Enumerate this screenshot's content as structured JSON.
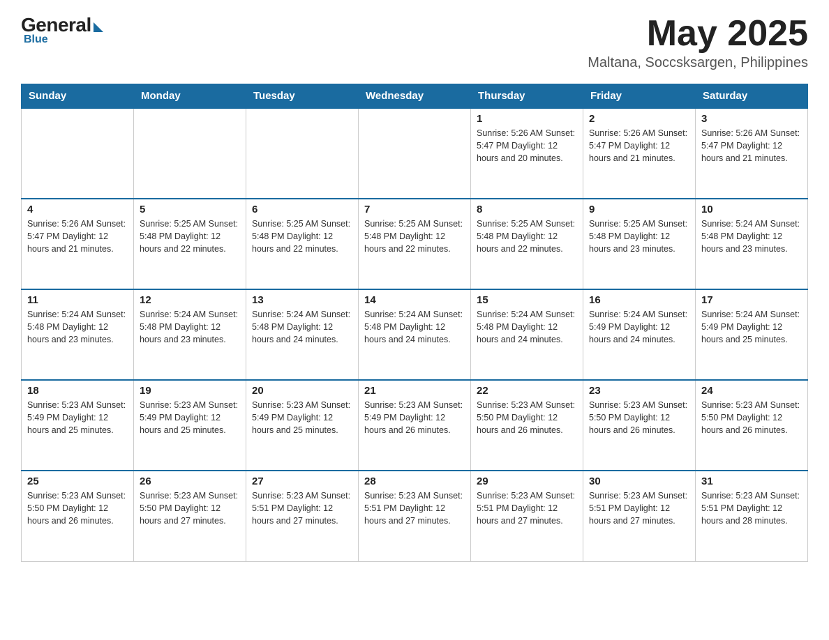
{
  "header": {
    "logo": {
      "general": "General",
      "blue": "Blue"
    },
    "title": "May 2025",
    "location": "Maltana, Soccsksargen, Philippines"
  },
  "calendar": {
    "days_of_week": [
      "Sunday",
      "Monday",
      "Tuesday",
      "Wednesday",
      "Thursday",
      "Friday",
      "Saturday"
    ],
    "weeks": [
      {
        "cells": [
          {
            "day": "",
            "info": ""
          },
          {
            "day": "",
            "info": ""
          },
          {
            "day": "",
            "info": ""
          },
          {
            "day": "",
            "info": ""
          },
          {
            "day": "1",
            "info": "Sunrise: 5:26 AM\nSunset: 5:47 PM\nDaylight: 12 hours\nand 20 minutes."
          },
          {
            "day": "2",
            "info": "Sunrise: 5:26 AM\nSunset: 5:47 PM\nDaylight: 12 hours\nand 21 minutes."
          },
          {
            "day": "3",
            "info": "Sunrise: 5:26 AM\nSunset: 5:47 PM\nDaylight: 12 hours\nand 21 minutes."
          }
        ]
      },
      {
        "cells": [
          {
            "day": "4",
            "info": "Sunrise: 5:26 AM\nSunset: 5:47 PM\nDaylight: 12 hours\nand 21 minutes."
          },
          {
            "day": "5",
            "info": "Sunrise: 5:25 AM\nSunset: 5:48 PM\nDaylight: 12 hours\nand 22 minutes."
          },
          {
            "day": "6",
            "info": "Sunrise: 5:25 AM\nSunset: 5:48 PM\nDaylight: 12 hours\nand 22 minutes."
          },
          {
            "day": "7",
            "info": "Sunrise: 5:25 AM\nSunset: 5:48 PM\nDaylight: 12 hours\nand 22 minutes."
          },
          {
            "day": "8",
            "info": "Sunrise: 5:25 AM\nSunset: 5:48 PM\nDaylight: 12 hours\nand 22 minutes."
          },
          {
            "day": "9",
            "info": "Sunrise: 5:25 AM\nSunset: 5:48 PM\nDaylight: 12 hours\nand 23 minutes."
          },
          {
            "day": "10",
            "info": "Sunrise: 5:24 AM\nSunset: 5:48 PM\nDaylight: 12 hours\nand 23 minutes."
          }
        ]
      },
      {
        "cells": [
          {
            "day": "11",
            "info": "Sunrise: 5:24 AM\nSunset: 5:48 PM\nDaylight: 12 hours\nand 23 minutes."
          },
          {
            "day": "12",
            "info": "Sunrise: 5:24 AM\nSunset: 5:48 PM\nDaylight: 12 hours\nand 23 minutes."
          },
          {
            "day": "13",
            "info": "Sunrise: 5:24 AM\nSunset: 5:48 PM\nDaylight: 12 hours\nand 24 minutes."
          },
          {
            "day": "14",
            "info": "Sunrise: 5:24 AM\nSunset: 5:48 PM\nDaylight: 12 hours\nand 24 minutes."
          },
          {
            "day": "15",
            "info": "Sunrise: 5:24 AM\nSunset: 5:48 PM\nDaylight: 12 hours\nand 24 minutes."
          },
          {
            "day": "16",
            "info": "Sunrise: 5:24 AM\nSunset: 5:49 PM\nDaylight: 12 hours\nand 24 minutes."
          },
          {
            "day": "17",
            "info": "Sunrise: 5:24 AM\nSunset: 5:49 PM\nDaylight: 12 hours\nand 25 minutes."
          }
        ]
      },
      {
        "cells": [
          {
            "day": "18",
            "info": "Sunrise: 5:23 AM\nSunset: 5:49 PM\nDaylight: 12 hours\nand 25 minutes."
          },
          {
            "day": "19",
            "info": "Sunrise: 5:23 AM\nSunset: 5:49 PM\nDaylight: 12 hours\nand 25 minutes."
          },
          {
            "day": "20",
            "info": "Sunrise: 5:23 AM\nSunset: 5:49 PM\nDaylight: 12 hours\nand 25 minutes."
          },
          {
            "day": "21",
            "info": "Sunrise: 5:23 AM\nSunset: 5:49 PM\nDaylight: 12 hours\nand 26 minutes."
          },
          {
            "day": "22",
            "info": "Sunrise: 5:23 AM\nSunset: 5:50 PM\nDaylight: 12 hours\nand 26 minutes."
          },
          {
            "day": "23",
            "info": "Sunrise: 5:23 AM\nSunset: 5:50 PM\nDaylight: 12 hours\nand 26 minutes."
          },
          {
            "day": "24",
            "info": "Sunrise: 5:23 AM\nSunset: 5:50 PM\nDaylight: 12 hours\nand 26 minutes."
          }
        ]
      },
      {
        "cells": [
          {
            "day": "25",
            "info": "Sunrise: 5:23 AM\nSunset: 5:50 PM\nDaylight: 12 hours\nand 26 minutes."
          },
          {
            "day": "26",
            "info": "Sunrise: 5:23 AM\nSunset: 5:50 PM\nDaylight: 12 hours\nand 27 minutes."
          },
          {
            "day": "27",
            "info": "Sunrise: 5:23 AM\nSunset: 5:51 PM\nDaylight: 12 hours\nand 27 minutes."
          },
          {
            "day": "28",
            "info": "Sunrise: 5:23 AM\nSunset: 5:51 PM\nDaylight: 12 hours\nand 27 minutes."
          },
          {
            "day": "29",
            "info": "Sunrise: 5:23 AM\nSunset: 5:51 PM\nDaylight: 12 hours\nand 27 minutes."
          },
          {
            "day": "30",
            "info": "Sunrise: 5:23 AM\nSunset: 5:51 PM\nDaylight: 12 hours\nand 27 minutes."
          },
          {
            "day": "31",
            "info": "Sunrise: 5:23 AM\nSunset: 5:51 PM\nDaylight: 12 hours\nand 28 minutes."
          }
        ]
      }
    ]
  }
}
